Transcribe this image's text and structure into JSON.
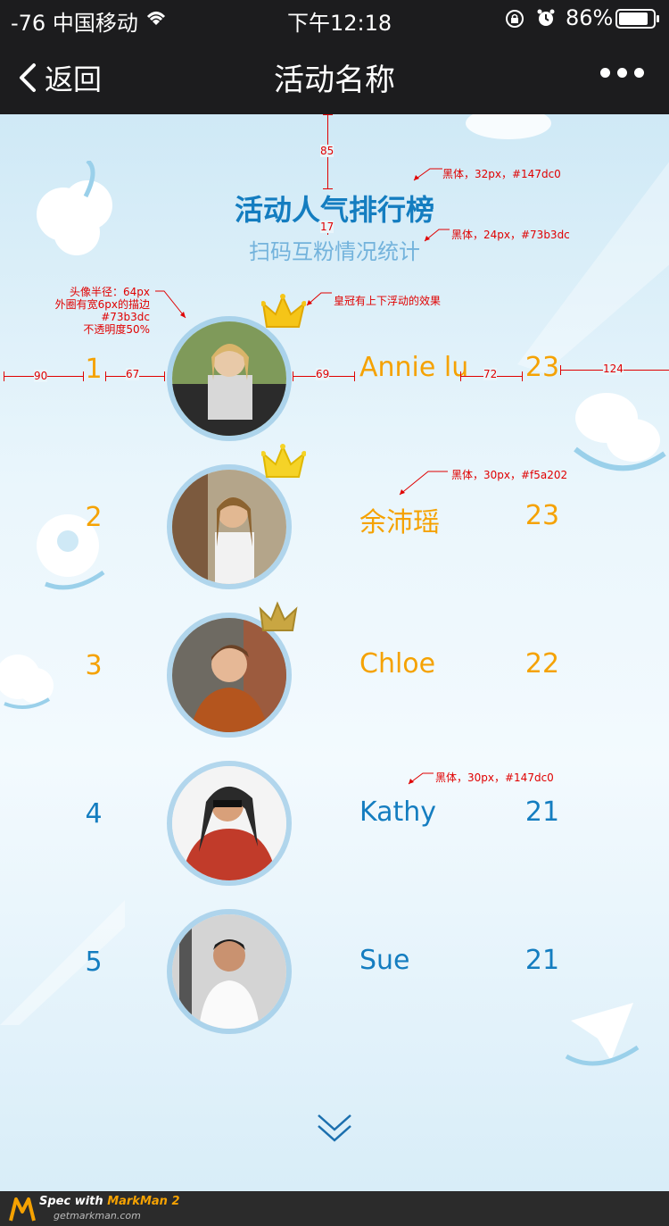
{
  "status_bar": {
    "signal": "-76 中国移动",
    "time": "下午12:18",
    "battery": "86%"
  },
  "nav": {
    "back_label": "返回",
    "title": "活动名称"
  },
  "board": {
    "title": "活动人气排行榜",
    "subtitle": "扫码互粉情况统计"
  },
  "ranking": [
    {
      "rank": "1",
      "name": "Annie lu",
      "score": "23"
    },
    {
      "rank": "2",
      "name": "余沛瑶",
      "score": "23"
    },
    {
      "rank": "3",
      "name": "Chloe",
      "score": "22"
    },
    {
      "rank": "4",
      "name": "Kathy",
      "score": "21"
    },
    {
      "rank": "5",
      "name": "Sue",
      "score": "21"
    }
  ],
  "annotations": {
    "m85": "85",
    "m17": "17",
    "m90": "90",
    "m67": "67",
    "m69": "69",
    "m72": "72",
    "m124": "124",
    "title_font": "黑体，32px，#147dc0",
    "subtitle_font": "黑体，24px，#73b3dc",
    "avatar_line1": "头像半径：64px",
    "avatar_line2": "外圈有宽6px的描边",
    "avatar_line3": "#73b3dc",
    "avatar_line4": "不透明度50%",
    "crown_note": "皇冠有上下浮动的效果",
    "gold_font": "黑体，30px，#f5a202",
    "blue_font": "黑体，30px，#147dc0"
  },
  "footer": {
    "spec_prefix": "Spec with ",
    "spec_app": "MarkMan 2",
    "site": "getmarkman.com"
  },
  "colors": {
    "title": "#147dc0",
    "subtitle": "#73b3dc",
    "top3": "#f5a202",
    "others": "#147dc0",
    "annotation": "#e00000"
  }
}
